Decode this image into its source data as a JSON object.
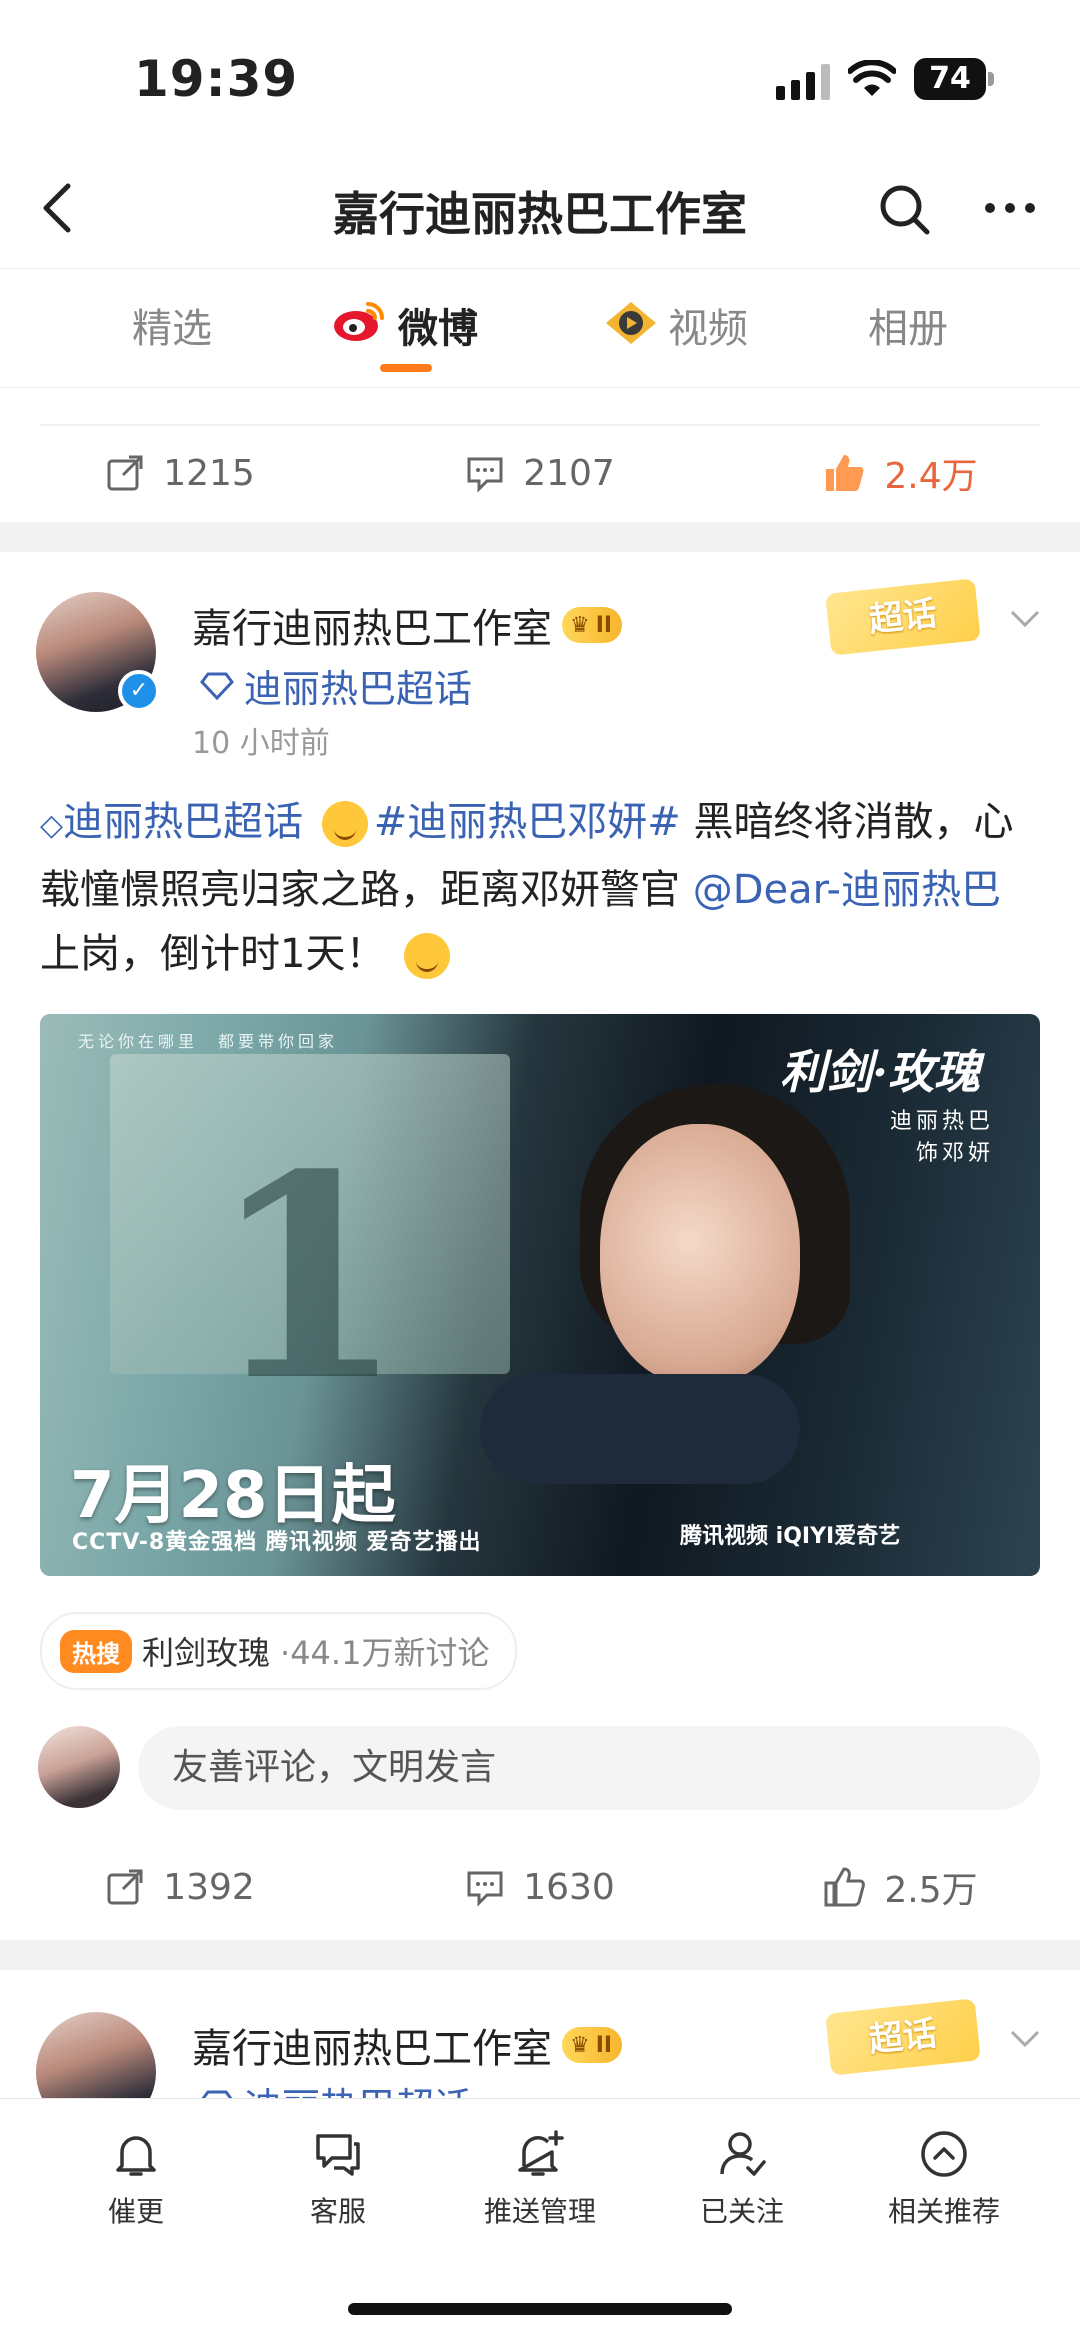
{
  "status_bar": {
    "time": "19:39",
    "battery": "74"
  },
  "header": {
    "title": "嘉行迪丽热巴工作室"
  },
  "tabs": [
    {
      "label": "精选",
      "active": false
    },
    {
      "label": "微博",
      "active": true
    },
    {
      "label": "视频",
      "active": false
    },
    {
      "label": "相册",
      "active": false
    }
  ],
  "prev_post": {
    "reposts": "1215",
    "comments": "2107",
    "likes": "2.4万"
  },
  "post": {
    "author": "嘉行迪丽热巴工作室",
    "vip_level": "II",
    "super_topic": "迪丽热巴超话",
    "time": "10 小时前",
    "chaohua_badge": "超话",
    "text": {
      "topic": "迪丽热巴超话",
      "hashtag": "#迪丽热巴邓妍#",
      "body1": " 黑暗终将消散，心载憧憬照亮归家之路，距离邓妍警官",
      "mention": "@Dear-迪丽热巴",
      "body2": " 上岗，倒计时1天！"
    },
    "poster": {
      "topline": "无论你在哪里　都要带你回家",
      "logo": "利剑·玫瑰",
      "cast_name": "迪丽热巴",
      "cast_role": "饰邓妍",
      "big_number": "1",
      "date": "7月28日起",
      "sub": "CCTV-8黄金强档  腾讯视频  爱奇艺播出",
      "brands": "腾讯视频  iQIYI爱奇艺"
    },
    "hot": {
      "tag": "热搜",
      "topic": "利剑玫瑰",
      "count": "·44.1万新讨论"
    },
    "comment_placeholder": "友善评论，文明发言",
    "reposts": "1392",
    "comments": "1630",
    "likes": "2.5万"
  },
  "next_post": {
    "author": "嘉行迪丽热巴工作室",
    "vip_level": "II",
    "super_topic": "迪丽热巴超话",
    "chaohua_badge": "超话"
  },
  "bottom_bar": [
    {
      "label": "催更",
      "icon": "bell-icon"
    },
    {
      "label": "客服",
      "icon": "chat-icon"
    },
    {
      "label": "推送管理",
      "icon": "bell-plus-icon"
    },
    {
      "label": "已关注",
      "icon": "user-check-icon"
    },
    {
      "label": "相关推荐",
      "icon": "chevron-up-circle-icon"
    }
  ],
  "colors": {
    "accent": "#ff7a1a",
    "link": "#3b63b3",
    "liked": "#e8663d"
  }
}
